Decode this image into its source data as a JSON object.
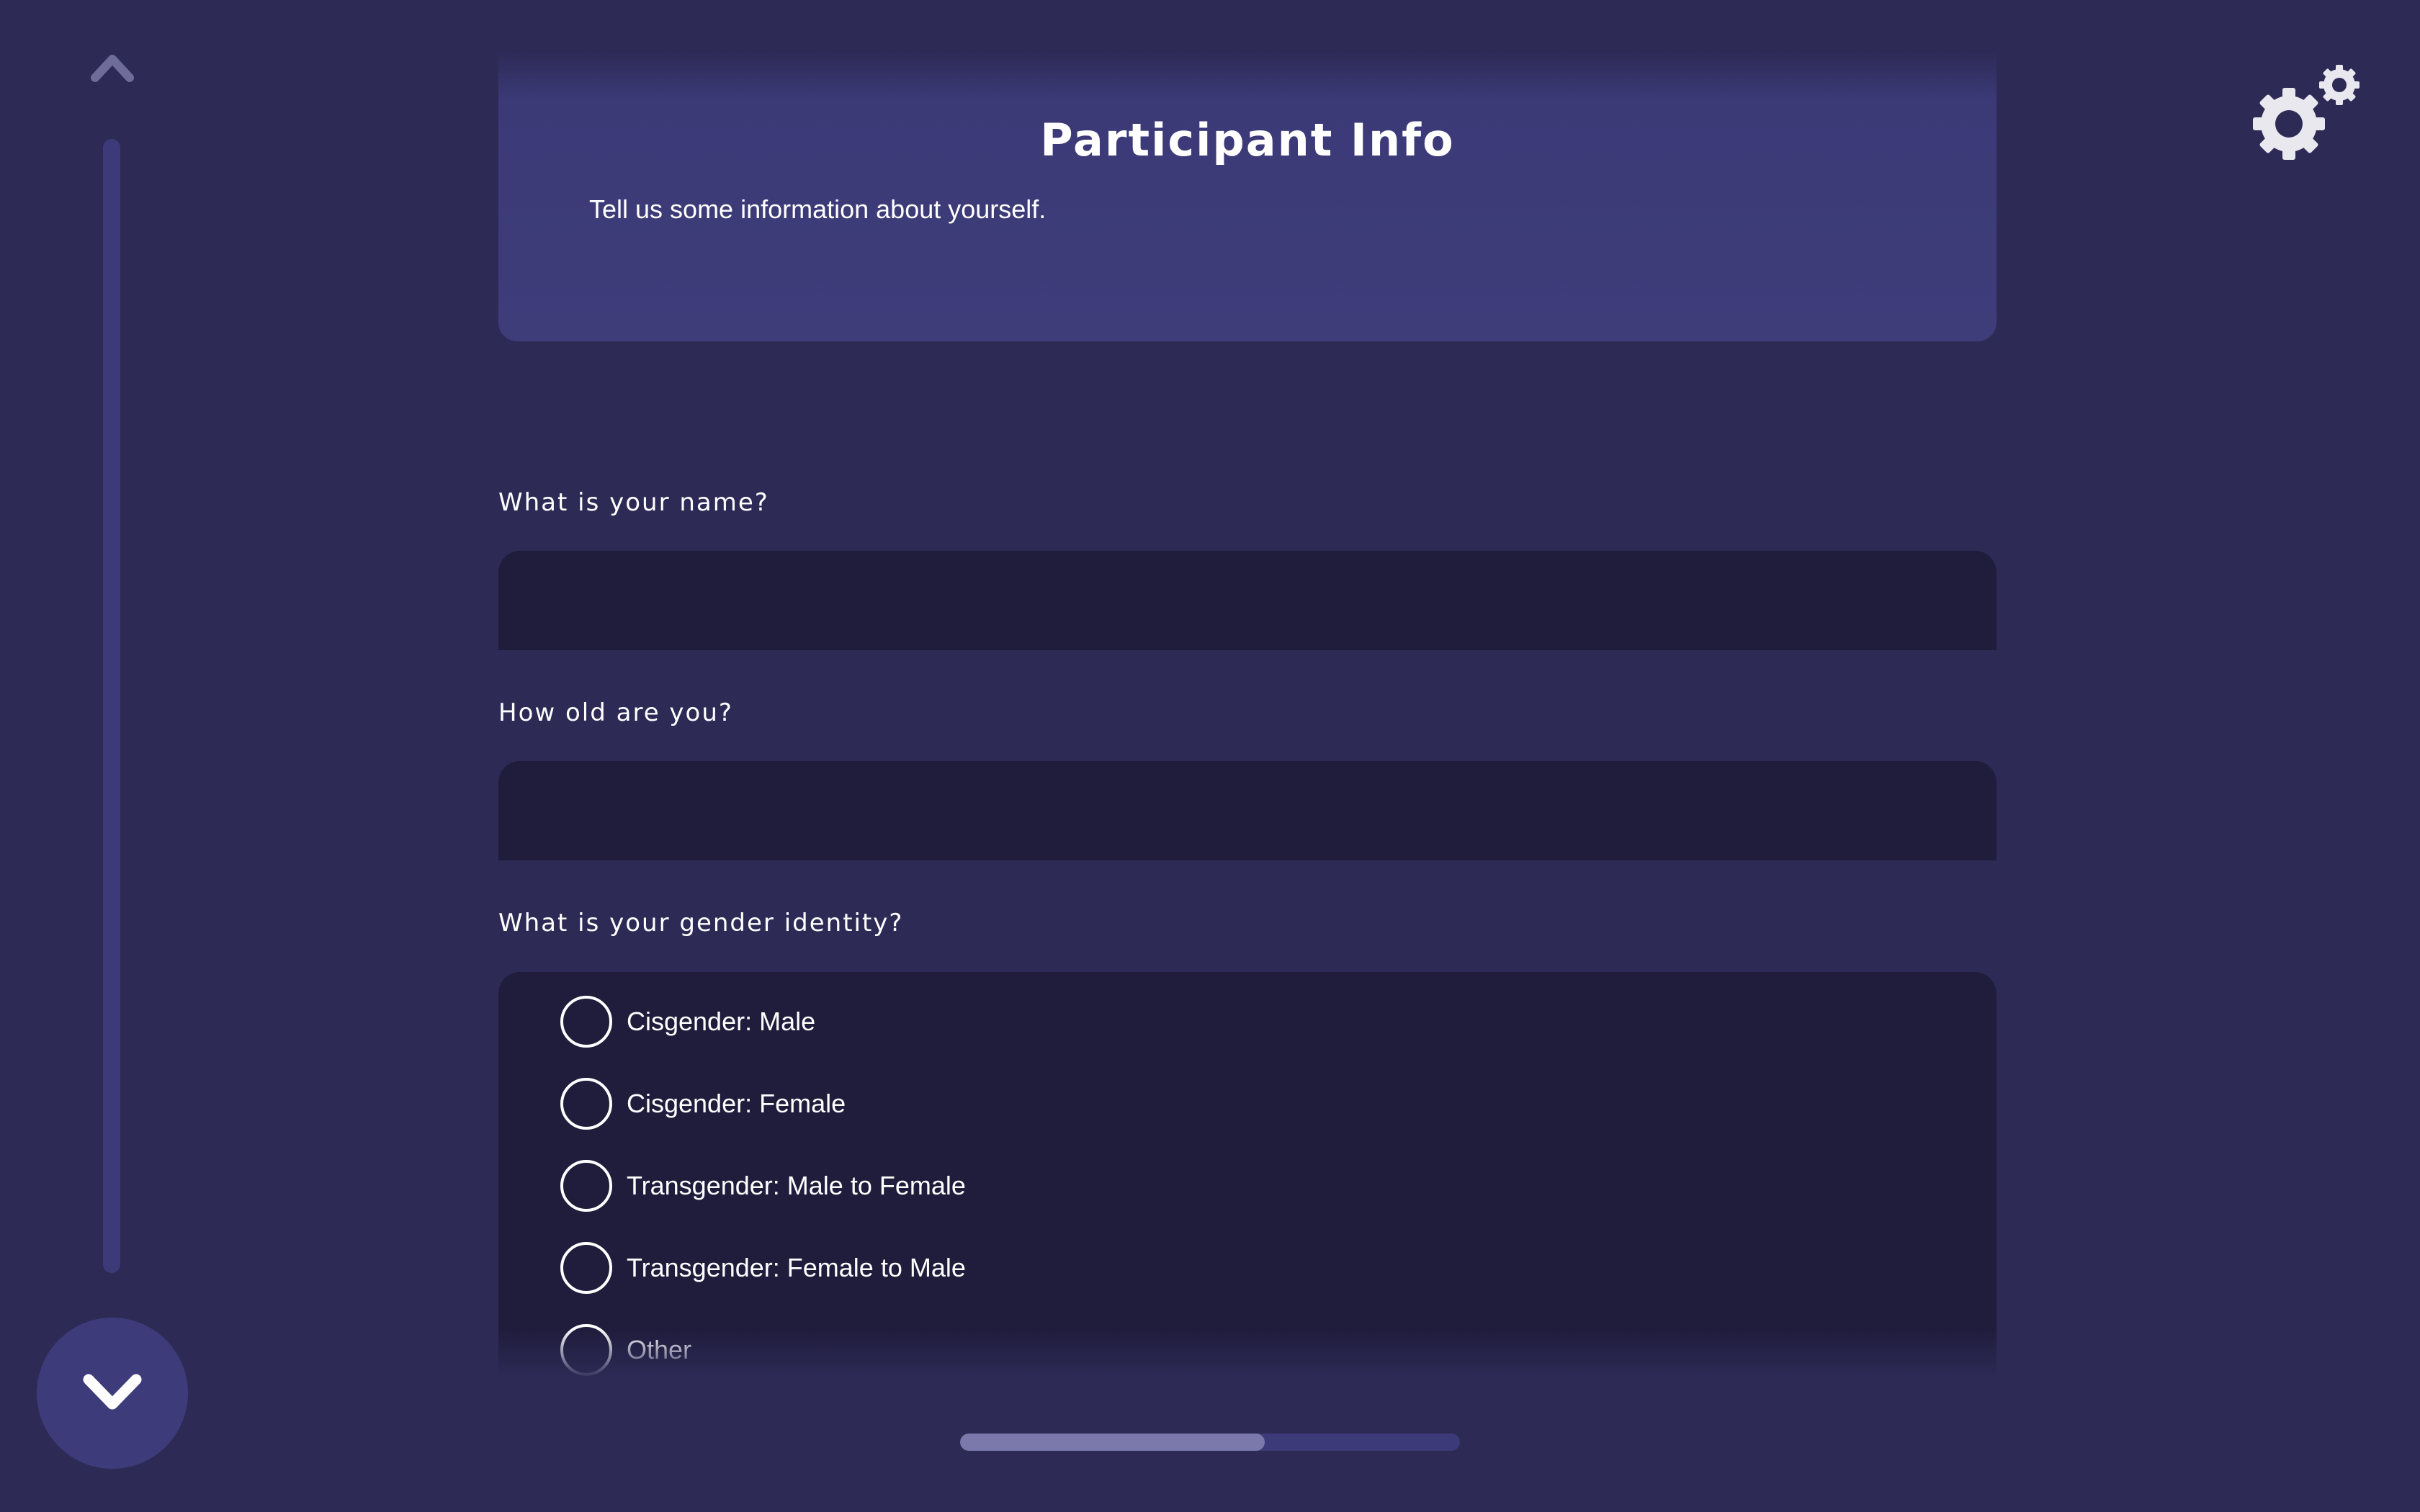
{
  "nav": {
    "up_icon": "chevron-up-icon",
    "down_icon": "chevron-down-icon",
    "settings_icon": "gears-icon"
  },
  "header": {
    "title": "Participant Info",
    "subtitle": "Tell us some information about yourself."
  },
  "questions": {
    "name": {
      "label": "What is your name?",
      "value": ""
    },
    "age": {
      "label": "How old are you?",
      "value": ""
    },
    "gender": {
      "label": "What is your gender identity?",
      "options": [
        "Cisgender: Male",
        "Cisgender: Female",
        "Transgender: Male to Female",
        "Transgender: Female to Male",
        "Other"
      ]
    }
  },
  "progress": {
    "fraction": 0.61
  },
  "colors": {
    "background": "#2d2a56",
    "card": "#3e3d7a",
    "field": "#1f1c3c",
    "accent": "#3d3b79",
    "progress_fill": "#7b79ab"
  }
}
